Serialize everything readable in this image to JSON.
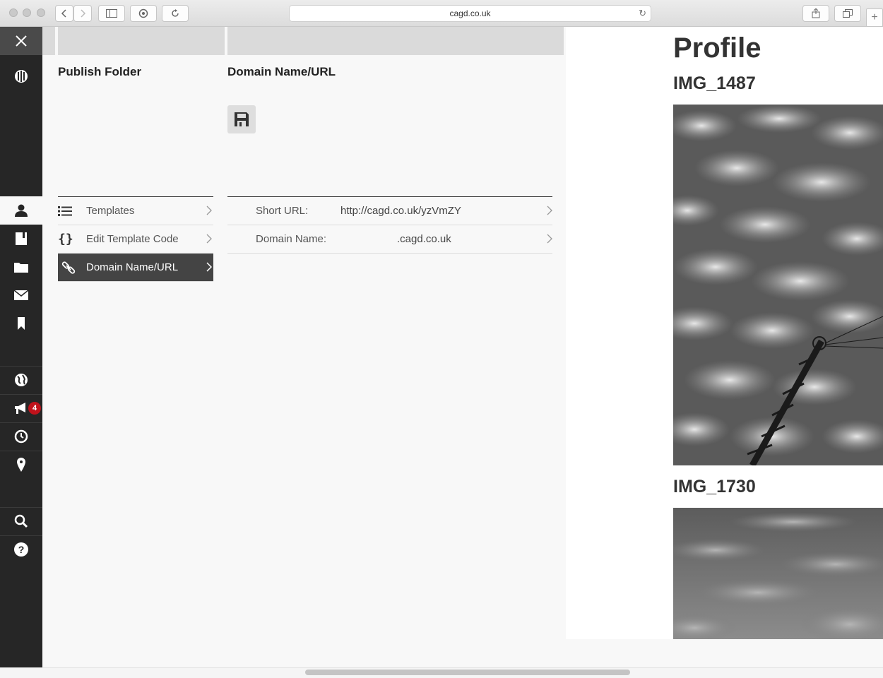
{
  "browser": {
    "url": "cagd.co.uk"
  },
  "sidebar": {
    "badge_count": "4",
    "items": [
      {
        "icon": "close-icon"
      },
      {
        "icon": "logo-icon"
      },
      {
        "icon": "user-icon"
      },
      {
        "icon": "book-icon"
      },
      {
        "icon": "folder-icon"
      },
      {
        "icon": "mail-icon"
      },
      {
        "icon": "bookmark-icon"
      },
      {
        "icon": "globe-icon"
      },
      {
        "icon": "megaphone-icon"
      },
      {
        "icon": "clock-icon"
      },
      {
        "icon": "pin-icon"
      },
      {
        "icon": "search-icon"
      },
      {
        "icon": "help-icon"
      }
    ]
  },
  "publish": {
    "title": "Publish Folder",
    "menu": [
      {
        "label": "Templates",
        "icon": "list-icon"
      },
      {
        "label": "Edit Template Code",
        "icon": "braces-icon"
      },
      {
        "label": "Domain Name/URL",
        "icon": "link-icon"
      }
    ]
  },
  "domain": {
    "title": "Domain Name/URL",
    "save_icon": "floppy-icon",
    "fields": [
      {
        "label": "Short URL:",
        "value": "http://cagd.co.uk/yzVmZY"
      },
      {
        "label": "Domain Name:",
        "value": ".cagd.co.uk"
      }
    ]
  },
  "preview": {
    "title": "Profile",
    "images": [
      {
        "caption": "IMG_1487"
      },
      {
        "caption": "IMG_1730"
      }
    ]
  },
  "colors": {
    "sidebar_bg": "#262626",
    "active_menu_bg": "#444444",
    "badge_red": "#c0121b"
  }
}
